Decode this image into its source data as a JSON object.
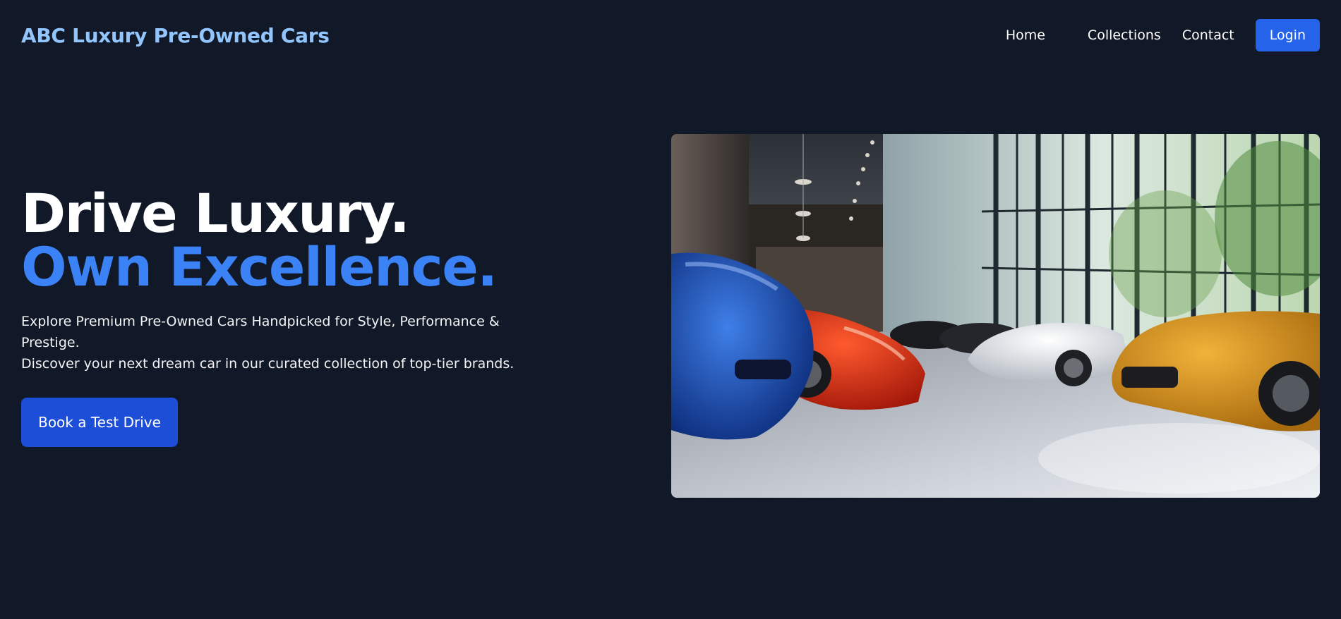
{
  "brand": "ABC Luxury Pre-Owned Cars",
  "nav": {
    "items": [
      {
        "label": "Home"
      },
      {
        "label": "Collections"
      },
      {
        "label": "Contact"
      }
    ],
    "login_label": "Login"
  },
  "hero": {
    "headline_line1": "Drive Luxury.",
    "headline_line2": "Own Excellence.",
    "subtitle_line1": "Explore Premium Pre-Owned Cars Handpicked for Style, Performance & Prestige.",
    "subtitle_line2": "Discover your next dream car in our curated collection of top-tier brands.",
    "cta_label": "Book a Test Drive",
    "image_subject": "luxury-car-showroom"
  },
  "colors": {
    "background": "#111827",
    "brand": "#93c5fd",
    "accent": "#3b82f6",
    "button": "#2563eb",
    "cta": "#1d4ed8"
  }
}
